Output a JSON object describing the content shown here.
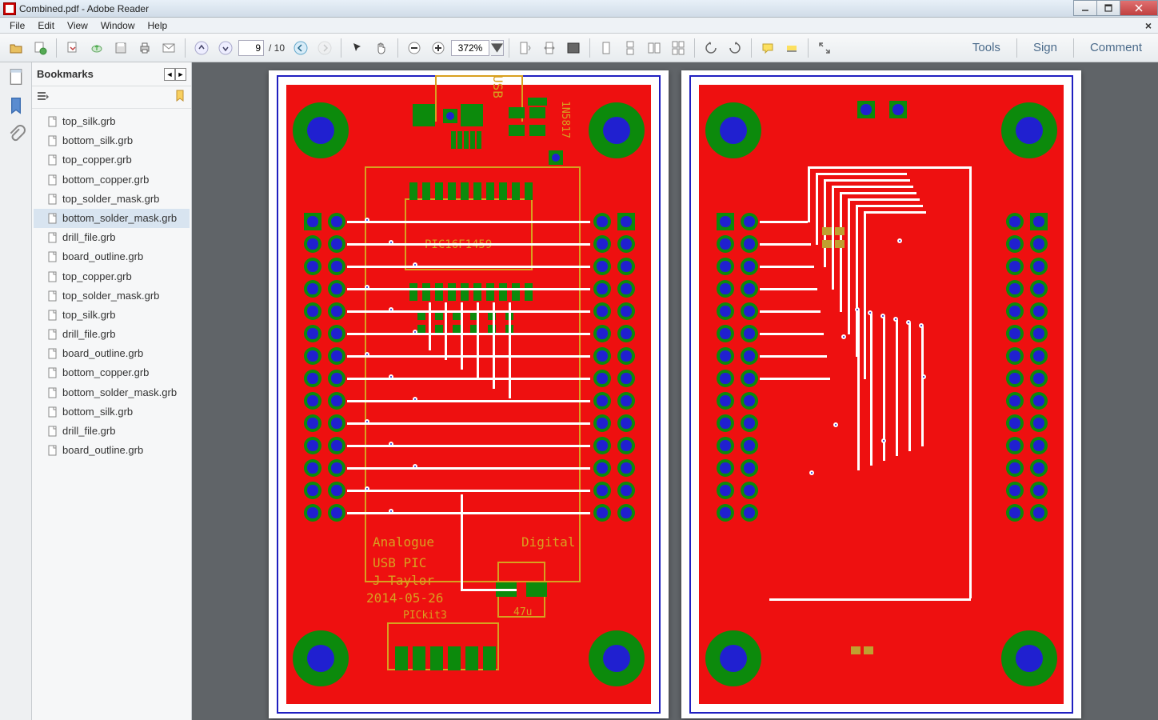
{
  "window": {
    "title": "Combined.pdf - Adobe Reader"
  },
  "menu": {
    "items": [
      "File",
      "Edit",
      "View",
      "Window",
      "Help"
    ]
  },
  "toolbar": {
    "page_current": "9",
    "page_total": "/ 10",
    "zoom": "372%",
    "right_buttons": [
      "Tools",
      "Sign",
      "Comment"
    ]
  },
  "bookmarks": {
    "title": "Bookmarks",
    "items": [
      {
        "label": "top_silk.grb"
      },
      {
        "label": "bottom_silk.grb"
      },
      {
        "label": "top_copper.grb"
      },
      {
        "label": "bottom_copper.grb"
      },
      {
        "label": "top_solder_mask.grb"
      },
      {
        "label": "bottom_solder_mask.grb",
        "selected": true
      },
      {
        "label": "drill_file.grb"
      },
      {
        "label": "board_outline.grb"
      },
      {
        "label": "top_copper.grb"
      },
      {
        "label": "top_solder_mask.grb"
      },
      {
        "label": "top_silk.grb"
      },
      {
        "label": "drill_file.grb"
      },
      {
        "label": "board_outline.grb"
      },
      {
        "label": "bottom_copper.grb"
      },
      {
        "label": "bottom_solder_mask.grb"
      },
      {
        "label": "bottom_silk.grb"
      },
      {
        "label": "drill_file.grb"
      },
      {
        "label": "board_outline.grb"
      }
    ]
  },
  "pcb": {
    "silk_labels": {
      "usb": "USB",
      "diode": "1N5817",
      "chip": "PIC16F1459",
      "analogue": "Analogue",
      "digital": "Digital",
      "title1": "USB PIC",
      "author": "J Taylor",
      "date": "2014-05-26",
      "pickit": "PICkit3",
      "cap": "47u"
    }
  }
}
